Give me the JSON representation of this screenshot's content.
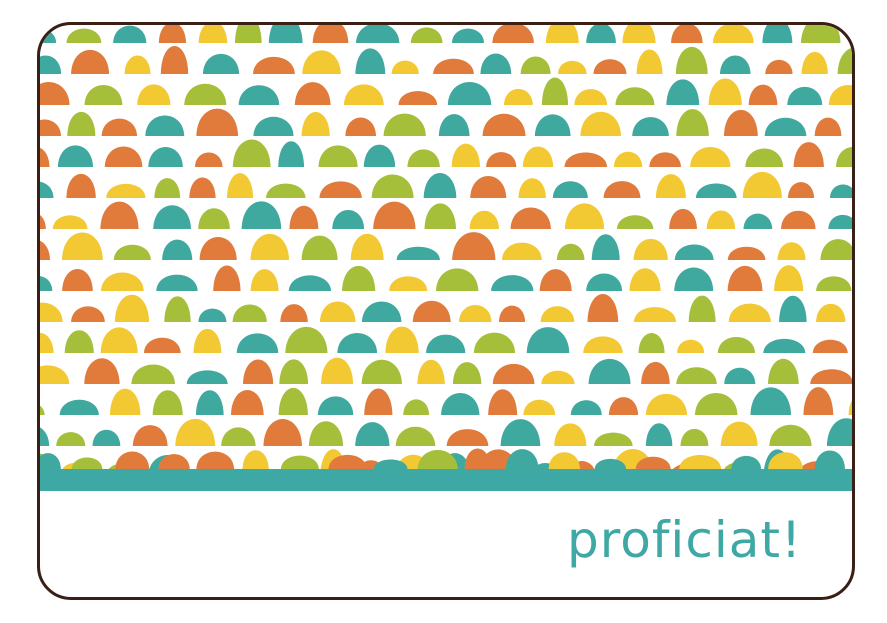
{
  "card": {
    "greeting": "proficiat!"
  },
  "pattern": {
    "shape": "scalloped hill rows",
    "colors": [
      "#3fa9a0",
      "#e07b3c",
      "#f3c933",
      "#a6bf3a"
    ]
  },
  "colors": {
    "accent": "#3ea8a4",
    "text": "#3ea8a4",
    "border": "#3a1f14",
    "background": "#ffffff"
  }
}
